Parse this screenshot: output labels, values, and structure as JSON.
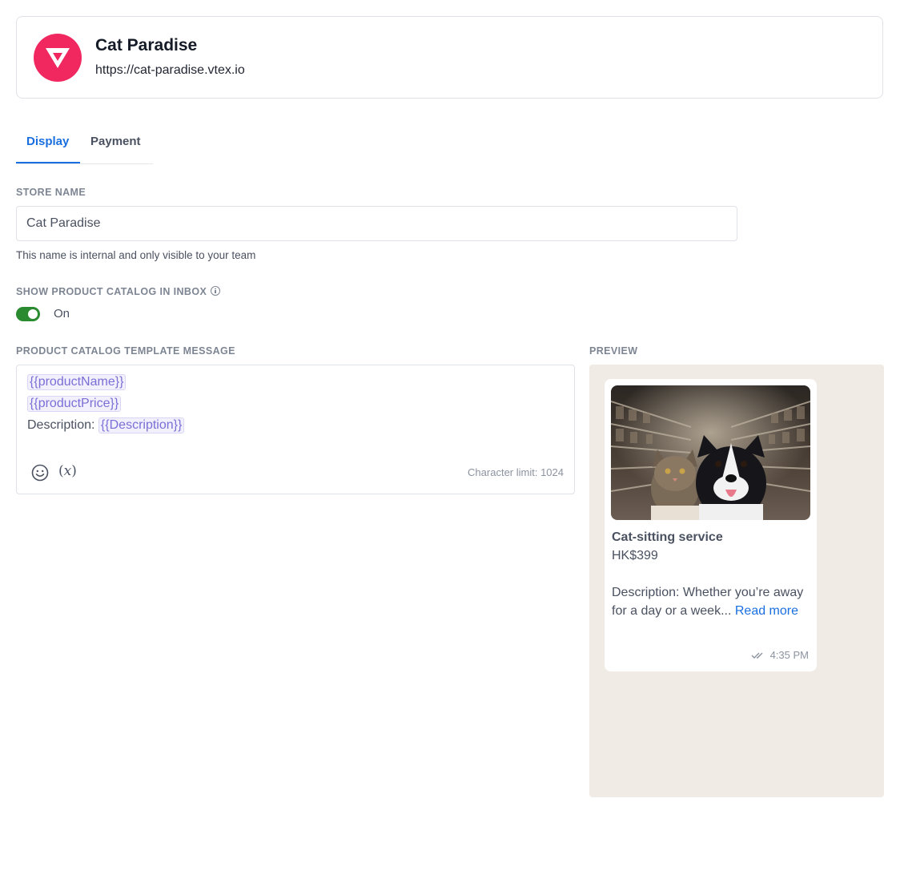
{
  "store": {
    "title": "Cat Paradise",
    "url": "https://cat-paradise.vtex.io",
    "logo_icon": "vtex-logo-icon",
    "brand_color": "#f0285f"
  },
  "tabs": [
    {
      "label": "Display",
      "active": true
    },
    {
      "label": "Payment",
      "active": false
    }
  ],
  "accent_color": "#1a6fe0",
  "store_name_field": {
    "label": "STORE NAME",
    "value": "Cat Paradise",
    "helper": "This name is internal and only visible to your team"
  },
  "catalog_toggle": {
    "label": "SHOW PRODUCT CATALOG IN INBOX",
    "state": "On",
    "on": true,
    "color": "#2a8a2f"
  },
  "template": {
    "label": "PRODUCT CATALOG TEMPLATE MESSAGE",
    "line1_var": "{{productName}}",
    "line2_var": "{{productPrice}}",
    "line3_prefix": "Description: ",
    "line3_var": "{{Description}}",
    "char_limit": "Character limit: 1024",
    "toolbar_icons": [
      "smiley-icon",
      "variable-fx-icon"
    ]
  },
  "preview": {
    "label": "PREVIEW",
    "product_name": "Cat-sitting service",
    "price": "HK$399",
    "description": "Description: Whether you’re away for a day or a week...",
    "read_more": "Read more",
    "time": "4:35 PM",
    "status_icon": "double-check-icon",
    "background_color": "#f0ece5"
  }
}
